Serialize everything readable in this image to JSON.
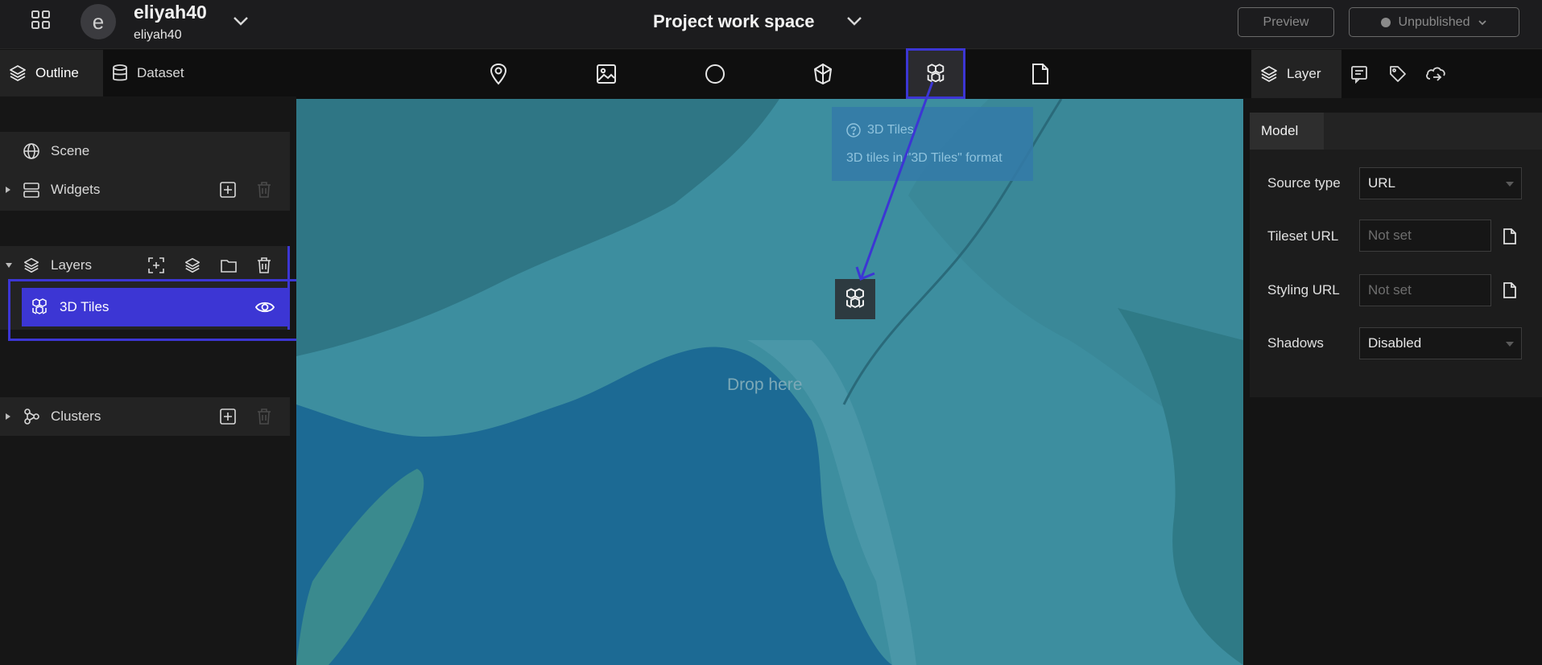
{
  "header": {
    "user_initial": "e",
    "user_name": "eliyah40",
    "user_sub": "eliyah40",
    "project_title": "Project work space",
    "preview_label": "Preview",
    "publish_label": "Unpublished"
  },
  "left": {
    "tabs": [
      {
        "label": "Outline",
        "icon": "layers-icon"
      },
      {
        "label": "Dataset",
        "icon": "database-icon"
      }
    ],
    "scene_label": "Scene",
    "widgets_label": "Widgets",
    "layers_label": "Layers",
    "selected_layer_label": "3D Tiles",
    "clusters_label": "Clusters"
  },
  "toolbar": {
    "icons": [
      "pin-icon",
      "image-icon",
      "circle-icon",
      "polygon-icon",
      "3d-tiles-icon",
      "file-icon"
    ],
    "active": "3d-tiles-icon"
  },
  "map": {
    "drop_label": "Drop here",
    "tooltip_title": "3D Tiles",
    "tooltip_desc": "3D tiles in \"3D Tiles\" format"
  },
  "right": {
    "active_tab": "Layer",
    "subtab": "Model",
    "fields": [
      {
        "label": "Source type",
        "value": "URL",
        "type": "select"
      },
      {
        "label": "Tileset URL",
        "placeholder": "Not set",
        "type": "text"
      },
      {
        "label": "Styling URL",
        "placeholder": "Not set",
        "type": "text"
      },
      {
        "label": "Shadows",
        "value": "Disabled",
        "type": "select"
      }
    ]
  },
  "colors": {
    "accent": "#3c36d4",
    "header_bg": "#1c1c1e",
    "panel_bg": "#232323",
    "map_water": "#1c6a94",
    "map_land": "#3b8a9a"
  }
}
